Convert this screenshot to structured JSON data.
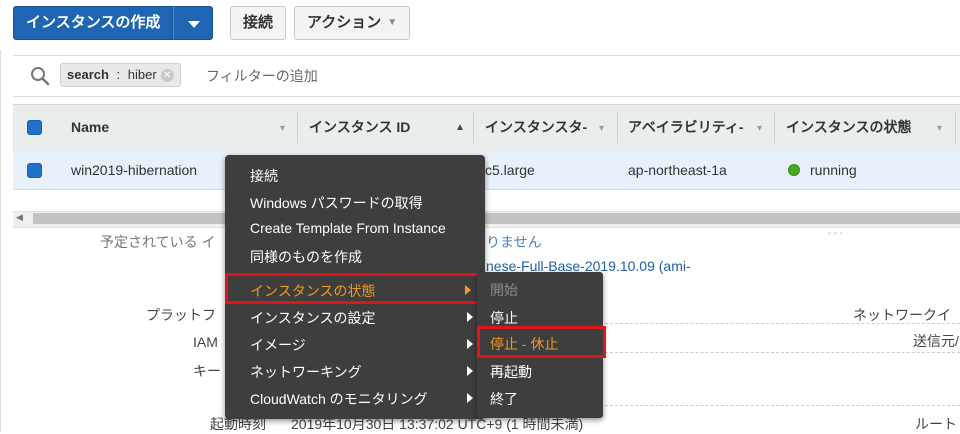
{
  "toolbar": {
    "launch_label": "インスタンスの作成",
    "connect_label": "接続",
    "actions_label": "アクション"
  },
  "search": {
    "token_key": "search",
    "token_sep": " : ",
    "token_value": "hiber",
    "placeholder": "フィルターの追加"
  },
  "table": {
    "columns": [
      "Name",
      "インスタンス ID",
      "インスタンスタ-",
      "アベイラビリティ-",
      "インスタンスの状態"
    ],
    "row": {
      "name": "win2019-hibernation",
      "type": "c5.large",
      "az": "ap-northeast-1a",
      "state": "running"
    }
  },
  "details": {
    "partial_top": "予定されている イ",
    "partial_top_link": "りません",
    "ami_text": "nese-Full-Base-2019.10.09 (ami-",
    "platform_label": "プラットフ",
    "iam_label": "IAM",
    "key_label": "キー",
    "launch_time_label": "起動時刻",
    "launch_time_value": "2019年10月30日 13:37:02 UTC+9 (1 時間未満)",
    "right_network": "ネットワークイ",
    "right_source": "送信元/",
    "right_root": "ルート",
    "ellipsis": "◦ ◦ ◦"
  },
  "context_menu": {
    "items": [
      "接続",
      "Windows パスワードの取得",
      "Create Template From Instance",
      "同様のものを作成",
      "インスタンスの状態",
      "インスタンスの設定",
      "イメージ",
      "ネットワーキング",
      "CloudWatch のモニタリング"
    ],
    "submenu": [
      "開始",
      "停止",
      "停止 - 休止",
      "再起動",
      "終了"
    ]
  },
  "colors": {
    "primary": "#1e65b3",
    "menu_bg": "#3e3e3e",
    "highlight_orange": "#f39a1e",
    "highlight_border": "#e1141c",
    "running_green": "#45a922"
  }
}
